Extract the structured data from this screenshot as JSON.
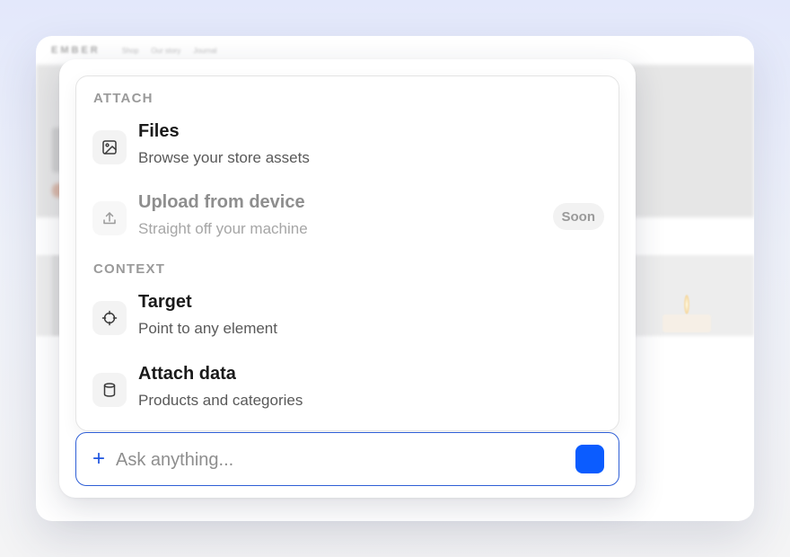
{
  "background_app": {
    "brand": "EMBER",
    "nav_links": [
      "Shop",
      "Our story",
      "Journal"
    ]
  },
  "menu": {
    "sections": [
      {
        "heading": "ATTACH",
        "items": [
          {
            "title": "Files",
            "subtitle": "Browse your store assets",
            "icon": "image-icon",
            "disabled": false
          },
          {
            "title": "Upload from device",
            "subtitle": "Straight off your machine",
            "icon": "upload-icon",
            "disabled": true,
            "badge": "Soon"
          }
        ]
      },
      {
        "heading": "CONTEXT",
        "items": [
          {
            "title": "Target",
            "subtitle": "Point to any element",
            "icon": "crosshair-icon",
            "disabled": false
          },
          {
            "title": "Attach data",
            "subtitle": "Products and categories",
            "icon": "database-icon",
            "disabled": false
          }
        ]
      }
    ]
  },
  "composer": {
    "plus_label": "+",
    "placeholder": "Ask anything...",
    "value": ""
  },
  "colors": {
    "accent": "#0b5cff",
    "input_border": "#2f5fd6",
    "heading_gray": "#9a9a9a"
  }
}
